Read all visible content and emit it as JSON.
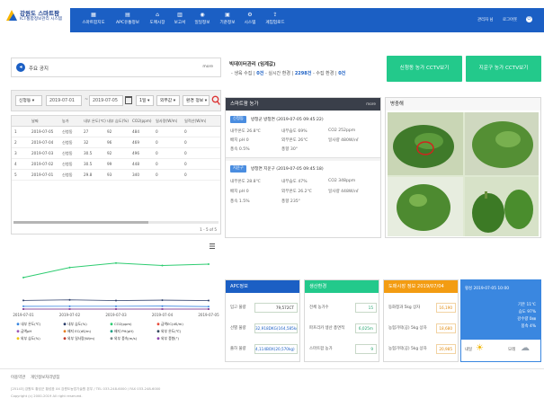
{
  "header": {
    "logo_title": "강원도 스마트팜",
    "logo_subtitle": "ICT통합정보관리 시스템",
    "nav": [
      {
        "label": "스마트팜지도",
        "icon": "map-icon"
      },
      {
        "label": "APC유통정보",
        "icon": "truck-icon"
      },
      {
        "label": "도매시장",
        "icon": "market-icon"
      },
      {
        "label": "보고서",
        "icon": "report-icon"
      },
      {
        "label": "일일정보",
        "icon": "calendar-icon"
      },
      {
        "label": "기준정보",
        "icon": "database-icon"
      },
      {
        "label": "시스템",
        "icon": "gear-icon"
      },
      {
        "label": "게임업로드",
        "icon": "upload-icon"
      }
    ],
    "user": "관리자 님",
    "logout": "로그아웃"
  },
  "notice": {
    "label": "주요 공지",
    "more": "more"
  },
  "warning": {
    "title": "빅데이터관리 (임계값)",
    "line_parts": [
      "- 생육 수집 |",
      "0건",
      "- 실시간 환경 |",
      "2298건",
      "- 수집 환경 |",
      "0건"
    ]
  },
  "cctv": {
    "btn1": "신청동 농가 CCTV보기",
    "btn2": "지운구 농가 CCTV보기"
  },
  "search": {
    "farm": "신청동",
    "date_from": "2019-07-01",
    "date_to": "2019-07-05",
    "period": "1일",
    "type": "외부값",
    "view": "환경 정보"
  },
  "table": {
    "headers": [
      "",
      "날짜",
      "농가",
      "내부 온도(℃)",
      "내부 습도(%)",
      "CO2(ppm)",
      "일사량(W/m)",
      "일적산(W/m)"
    ],
    "rows": [
      [
        "1",
        "2019-07-05",
        "신청동",
        "27",
        "92",
        "484",
        "0",
        "0"
      ],
      [
        "2",
        "2019-07-04",
        "신청동",
        "32",
        "96",
        "469",
        "0",
        "0"
      ],
      [
        "3",
        "2019-07-03",
        "신청동",
        "30.5",
        "92",
        "496",
        "0",
        "0"
      ],
      [
        "4",
        "2019-07-02",
        "신청동",
        "30.5",
        "99",
        "448",
        "0",
        "0"
      ],
      [
        "5",
        "2019-07-01",
        "신청동",
        "29.8",
        "93",
        "340",
        "0",
        "0"
      ]
    ],
    "pagination": "1 - 5 of 5"
  },
  "chart_data": {
    "type": "line",
    "x": [
      "2019-07-01",
      "2019-07-02",
      "2019-07-03",
      "2019-07-04",
      "2019-07-05"
    ],
    "series": [
      {
        "name": "내부 온도(℃)",
        "color": "#3a87e0",
        "values": [
          29.8,
          30.5,
          30.5,
          32,
          27
        ]
      },
      {
        "name": "내부 습도(%)",
        "color": "#2c3e6a",
        "values": [
          93,
          99,
          92,
          96,
          92
        ]
      },
      {
        "name": "CO2(ppm)",
        "color": "#2ecc71",
        "values": [
          340,
          448,
          496,
          469,
          484
        ]
      },
      {
        "name": "급액EC(dS/m)",
        "color": "#e74c3c",
        "values": [
          0,
          0,
          0,
          0,
          0
        ]
      },
      {
        "name": "급액pH",
        "color": "#9b59b6",
        "values": [
          0,
          0,
          0,
          0,
          0
        ]
      },
      {
        "name": "배지 EC(dS/m)",
        "color": "#e67e22",
        "values": [
          0,
          0,
          0,
          0,
          0
        ]
      },
      {
        "name": "배지 PH(pH)",
        "color": "#16a085",
        "values": [
          0,
          0,
          0,
          0,
          0
        ]
      },
      {
        "name": "외부 온도(℃)",
        "color": "#34495e",
        "values": [
          0,
          0,
          0,
          0,
          0
        ]
      },
      {
        "name": "외부 습도(%)",
        "color": "#f1c40f",
        "values": [
          0,
          0,
          0,
          0,
          0
        ]
      },
      {
        "name": "외부 일사량(W/m)",
        "color": "#c0392b",
        "values": [
          0,
          0,
          0,
          0,
          0
        ]
      },
      {
        "name": "외부 풍속(m/s)",
        "color": "#7f8c8d",
        "values": [
          0,
          0,
          0,
          0,
          0
        ]
      },
      {
        "name": "외부 풍향(°)",
        "color": "#8e44ad",
        "values": [
          0,
          0,
          0,
          0,
          0
        ]
      }
    ],
    "ylim": [
      0,
      600
    ],
    "legend": "bottom",
    "grid": false
  },
  "smartfarm": {
    "title": "스마트팜 농가",
    "more": "more",
    "farms": [
      {
        "badge": "신청동",
        "name": "방청군 방청면 (2019-07-05 09:45:22)",
        "col1": [
          "내부온도 26.8℃",
          "배지 pH 0",
          "풍속 0.5%"
        ],
        "col2": [
          "내부습도 69%",
          "외부온도 26℃",
          "풍향 30°"
        ],
        "col3": [
          "CO2 252ppm",
          "일사량 480W/㎡",
          ""
        ]
      },
      {
        "badge": "지운구",
        "name": "방청면 지운구 (2019-07-05 09:45:18)",
        "col1": [
          "내부온도 28.8℃",
          "배지 pH 0",
          "풍속 1.5%"
        ],
        "col2": [
          "내부습도 47%",
          "외부온도 26.2℃",
          "풍향 235°"
        ],
        "col3": [
          "CO2 348ppm",
          "일사량 448W/㎡",
          ""
        ]
      }
    ]
  },
  "disease": {
    "title": "병충해"
  },
  "apc": {
    "title": "APC정보",
    "color": "#1b5fc4",
    "rows": [
      {
        "label": "입고 물량",
        "value": "79,572CT"
      },
      {
        "label": "선별 물량",
        "value": "32,918DKG(164,585kg)"
      },
      {
        "label": "출하 물량",
        "value": "4,114BOX(20,570kg)"
      }
    ]
  },
  "production": {
    "title": "생산환경",
    "color": "#23c98b",
    "rows": [
      {
        "label": "전체 농가수",
        "value": "15"
      },
      {
        "label": "파프리카 생산 총면적",
        "value": "6,025m"
      },
      {
        "label": "스마트팜 농가",
        "value": "9"
      }
    ]
  },
  "market": {
    "title": "도매시장 정보 2019/07/04",
    "color": "#f39c12",
    "rows": [
      {
        "label": "동화청과 5kg 상자",
        "value": "16,190"
      },
      {
        "label": "농협가락(공) 5kg 상자",
        "value": "18,680"
      },
      {
        "label": "농협가락(공) 5kg 상자",
        "value": "20,985"
      }
    ]
  },
  "weather": {
    "time": "횡성 2019-07-05 10:00",
    "temp": "기온 11℃",
    "humidity": "습도 97%",
    "rain": "강수량 0㎜",
    "wind": "풍속 4%",
    "now_label": "내일",
    "later_label": "모레"
  },
  "footer": {
    "links": [
      "이용약관",
      "개인정보처리방침"
    ],
    "lines": [
      "[25143] 강원도 횡성군 횡성읍 XX 강원도농업기술원 본부 / TEL 033-248-6000 / FAX 033-248-6000",
      "Copyright (c) 2000-2019 All right reserved."
    ]
  }
}
